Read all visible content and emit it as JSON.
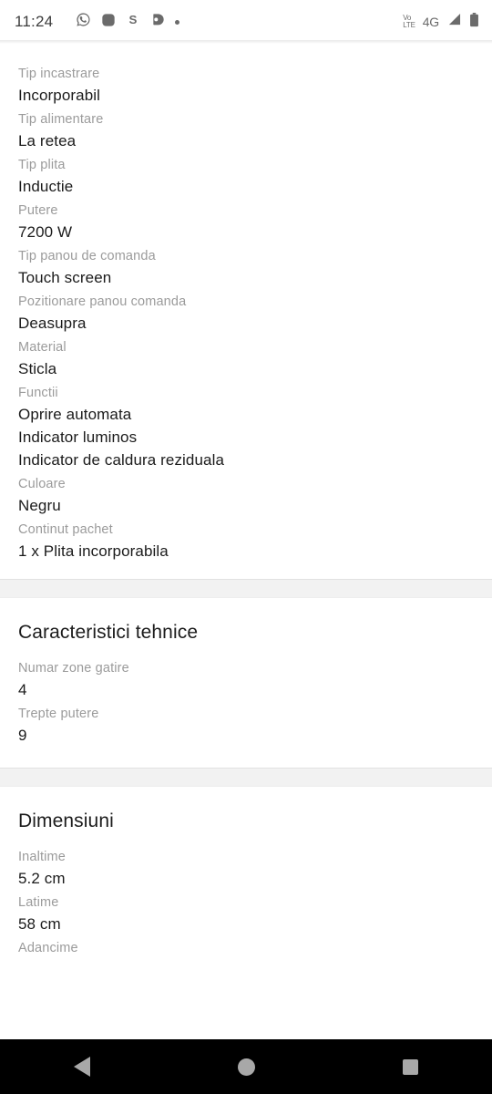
{
  "status_bar": {
    "time": "11:24",
    "left_icons": [
      {
        "name": "whatsapp-icon"
      },
      {
        "name": "messaging-icon"
      },
      {
        "name": "skype-icon",
        "glyph": "S"
      },
      {
        "name": "app-notification-icon"
      },
      {
        "name": "more-notifications-dot-icon"
      }
    ],
    "volte_line1": "Vo",
    "volte_line2": "LTE",
    "network": "4G",
    "signal_icon": "signal-bars-icon",
    "battery_icon": "battery-icon"
  },
  "specs": [
    {
      "label": "Tip incastrare",
      "values": [
        "Incorporabil"
      ]
    },
    {
      "label": "Tip alimentare",
      "values": [
        "La retea"
      ]
    },
    {
      "label": "Tip plita",
      "values": [
        "Inductie"
      ]
    },
    {
      "label": "Putere",
      "values": [
        "7200 W"
      ]
    },
    {
      "label": "Tip panou de comanda",
      "values": [
        "Touch screen"
      ]
    },
    {
      "label": "Pozitionare panou comanda",
      "values": [
        "Deasupra"
      ]
    },
    {
      "label": "Material",
      "values": [
        "Sticla"
      ]
    },
    {
      "label": "Functii",
      "values": [
        "Oprire automata",
        "Indicator luminos",
        "Indicator de caldura reziduala"
      ]
    },
    {
      "label": "Culoare",
      "values": [
        "Negru"
      ]
    },
    {
      "label": "Continut pachet",
      "values": [
        "1 x Plita incorporabila"
      ]
    }
  ],
  "sections": [
    {
      "title": "Caracteristici tehnice",
      "specs": [
        {
          "label": "Numar zone gatire",
          "values": [
            "4"
          ]
        },
        {
          "label": "Trepte putere",
          "values": [
            "9"
          ]
        }
      ]
    },
    {
      "title": "Dimensiuni",
      "specs": [
        {
          "label": "Inaltime",
          "values": [
            "5.2 cm"
          ]
        },
        {
          "label": "Latime",
          "values": [
            "58 cm"
          ]
        },
        {
          "label": "Adancime",
          "values": []
        }
      ]
    }
  ],
  "nav_bar": {
    "back": "back-button",
    "home": "home-button",
    "recents": "recents-button"
  },
  "colors": {
    "label": "#9b9b9b",
    "value": "#1b1b1b",
    "divider": "#f2f2f2",
    "nav_background": "#000000",
    "nav_icon": "#a8a8a8"
  }
}
